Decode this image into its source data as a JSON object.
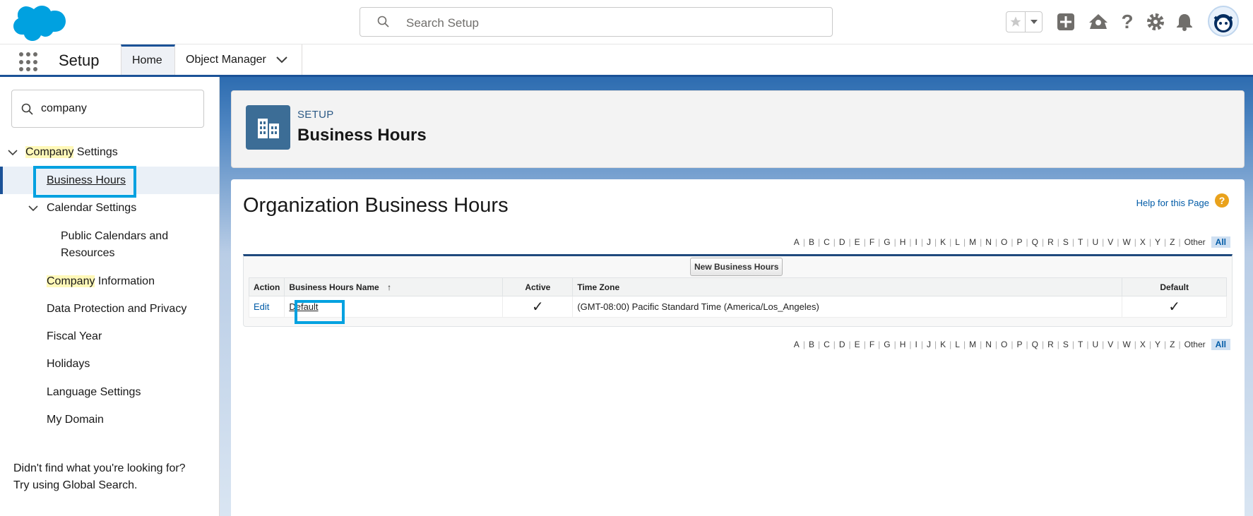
{
  "header": {
    "search_placeholder": "Search Setup",
    "icons": [
      "favorites-star-icon",
      "global-add-icon",
      "trailhead-icon",
      "help-icon",
      "setup-gear-icon",
      "notifications-bell-icon",
      "user-avatar"
    ]
  },
  "nav": {
    "app_name": "Setup",
    "tabs": [
      {
        "label": "Home",
        "active": true
      },
      {
        "label": "Object Manager",
        "active": false
      }
    ]
  },
  "sidebar": {
    "search_value": "company",
    "tree": {
      "company_settings": {
        "highlight": "Company",
        "rest": " Settings"
      },
      "business_hours": "Business Hours",
      "calendar_settings": "Calendar Settings",
      "public_calendars_1": "Public Calendars and",
      "public_calendars_2": "Resources",
      "company_information": {
        "highlight": "Company",
        "rest": " Information"
      },
      "data_protection": "Data Protection and Privacy",
      "fiscal_year": "Fiscal Year",
      "holidays": "Holidays",
      "language_settings": "Language Settings",
      "my_domain": "My Domain"
    },
    "hint_line1": "Didn't find what you're looking for?",
    "hint_line2": "Try using Global Search."
  },
  "page_header": {
    "eyebrow": "SETUP",
    "title": "Business Hours"
  },
  "main": {
    "title": "Organization Business Hours",
    "help_link": "Help for this Page",
    "help_icon": "?",
    "alpha_letters": [
      "A",
      "B",
      "C",
      "D",
      "E",
      "F",
      "G",
      "H",
      "I",
      "J",
      "K",
      "L",
      "M",
      "N",
      "O",
      "P",
      "Q",
      "R",
      "S",
      "T",
      "U",
      "V",
      "W",
      "X",
      "Y",
      "Z"
    ],
    "alpha_other": "Other",
    "alpha_all": "All",
    "new_button": "New Business Hours",
    "columns": {
      "action": "Action",
      "name": "Business Hours Name",
      "sort_indicator": "↑",
      "active": "Active",
      "time_zone": "Time Zone",
      "default": "Default"
    },
    "rows": [
      {
        "action": "Edit",
        "name": "Default",
        "active": "✓",
        "time_zone": "(GMT-08:00) Pacific Standard Time (America/Los_Angeles)",
        "default": "✓"
      }
    ]
  },
  "colors": {
    "brand_blue": "#1b5297",
    "highlight_box": "#00a1e0",
    "search_highlight": "#fff8b8",
    "link": "#015ba7"
  }
}
